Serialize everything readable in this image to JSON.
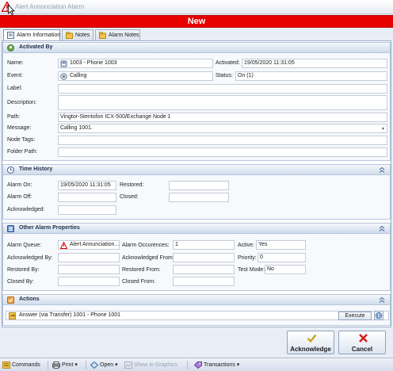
{
  "window": {
    "title": "Alert Annunciation Alarm"
  },
  "banner": {
    "text": "New",
    "color": "#e60000"
  },
  "tabs": [
    {
      "label": "Alarm Information",
      "active": true
    },
    {
      "label": "Notes",
      "active": false
    },
    {
      "label": "Alarm Notes",
      "active": false
    }
  ],
  "activated_by": {
    "title": "Activated By",
    "name_label": "Name:",
    "name_value": "1003 - Phone 1003",
    "activated_label": "Activated:",
    "activated_value": "19/05/2020 11:31:05",
    "event_label": "Event:",
    "event_value": "Calling",
    "status_label": "Status:",
    "status_value": "On (1)",
    "label_label": "Label:",
    "label_value": "",
    "description_label": "Description:",
    "description_value": "",
    "path_label": "Path:",
    "path_value": "Vingtor-Stentofon ICX-500/Exchange Node 1",
    "message_label": "Message:",
    "message_value": "Calling 1001.",
    "node_tags_label": "Node Tags:",
    "node_tags_value": "",
    "folder_path_label": "Folder Path:",
    "folder_path_value": ""
  },
  "time_history": {
    "title": "Time History",
    "alarm_on_label": "Alarm On:",
    "alarm_on_value": "19/05/2020 11:31:05",
    "restored_label": "Restored:",
    "restored_value": "",
    "alarm_off_label": "Alarm Off:",
    "alarm_off_value": "",
    "closed_label": "Closed:",
    "closed_value": "",
    "acknowledged_label": "Acknowledged:",
    "acknowledged_value": ""
  },
  "other_props": {
    "title": "Other Alarm Properties",
    "queue_label": "Alarm Queue:",
    "queue_value": "Alert Annunciation...",
    "occurrences_label": "Alarm Occurences:",
    "occurrences_value": "1",
    "active_label": "Active:",
    "active_value": "Yes",
    "ack_by_label": "Acknowledged By:",
    "ack_by_value": "",
    "ack_from_label": "Acknowledged From:",
    "ack_from_value": "",
    "priority_label": "Priority:",
    "priority_value": "0",
    "restored_by_label": "Restored By:",
    "restored_by_value": "",
    "restored_from_label": "Restored From:",
    "restored_from_value": "",
    "test_mode_label": "Test Mode:",
    "test_mode_value": "No",
    "closed_by_label": "Closed By:",
    "closed_by_value": "",
    "closed_from_label": "Closed From:",
    "closed_from_value": ""
  },
  "actions": {
    "title": "Actions",
    "item": "Answer (via Transfer) 1001 - Phone 1001",
    "execute_label": "Execute"
  },
  "buttons": {
    "acknowledge": "Acknowledge",
    "cancel": "Cancel"
  },
  "statusbar": {
    "commands": "Commands",
    "print": "Print",
    "open": "Open",
    "show_in_graphics": "Show in Graphics",
    "transactions": "Transactions"
  }
}
